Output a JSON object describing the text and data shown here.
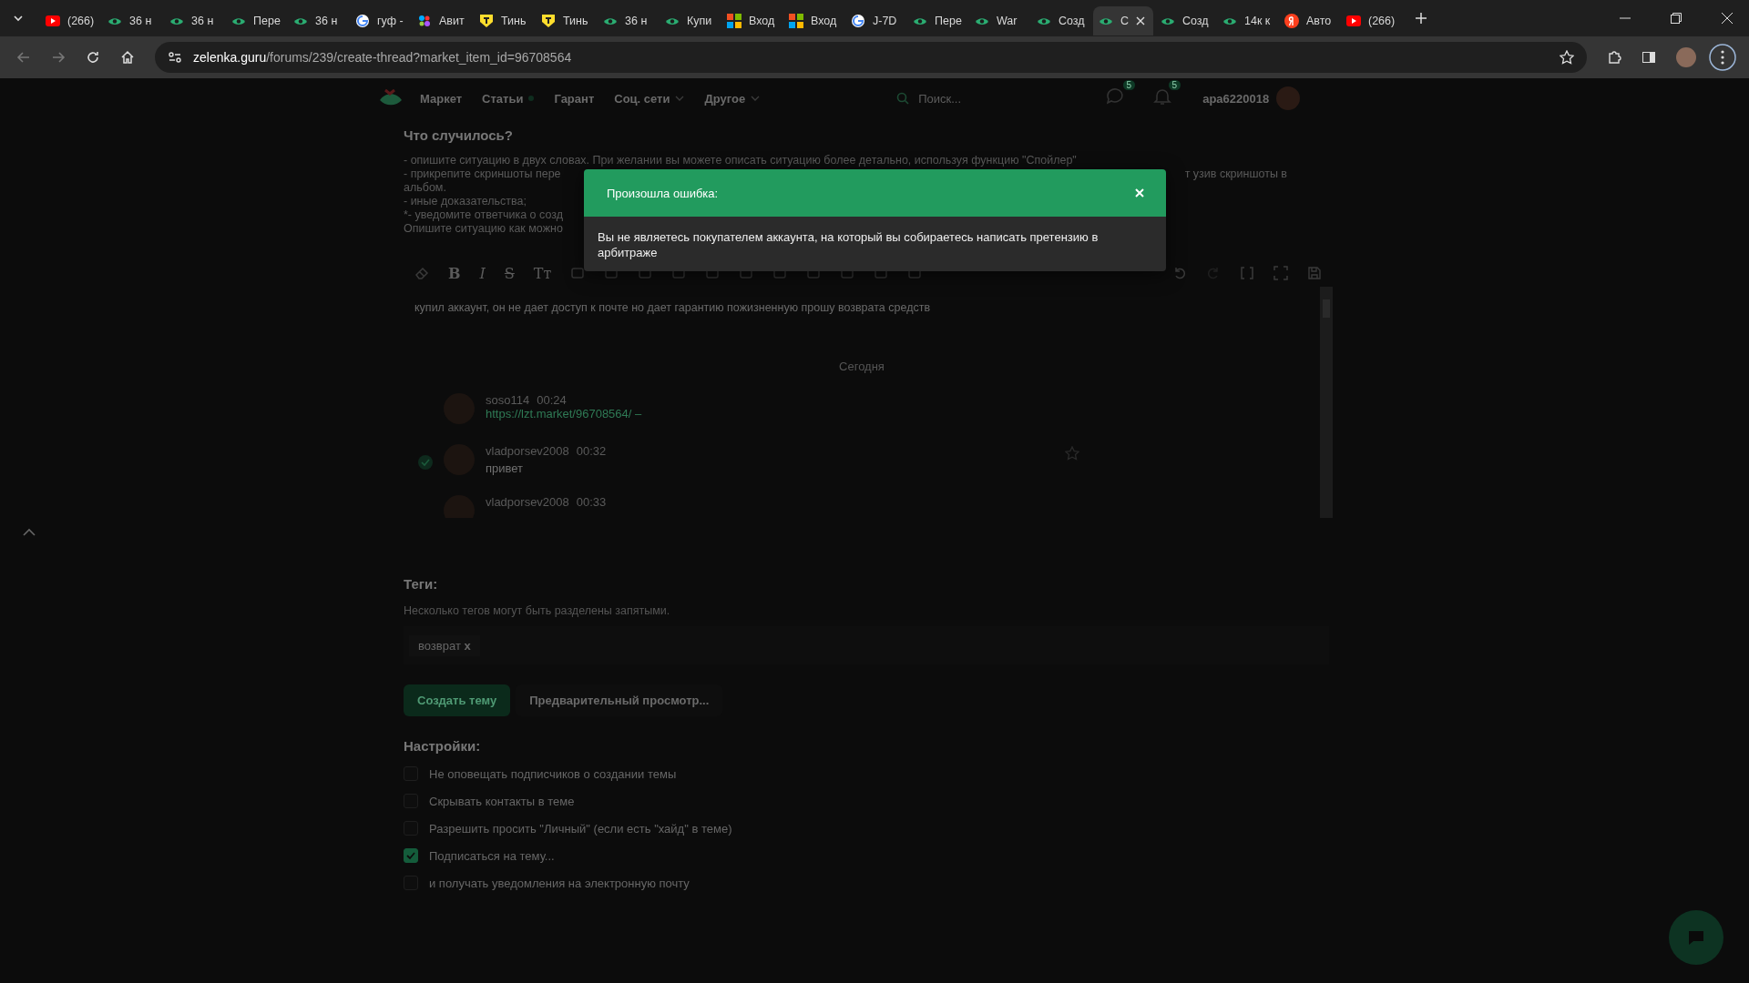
{
  "browser": {
    "tabs": [
      {
        "label": "(266)",
        "kind": "youtube",
        "selected": false
      },
      {
        "label": "36 н",
        "kind": "lolz",
        "selected": false
      },
      {
        "label": "36 н",
        "kind": "lolz",
        "selected": false
      },
      {
        "label": "Пере",
        "kind": "lolz",
        "selected": false
      },
      {
        "label": "36 н",
        "kind": "lolz",
        "selected": false
      },
      {
        "label": "гуф -",
        "kind": "google",
        "selected": false
      },
      {
        "label": "Авит",
        "kind": "avito",
        "selected": false
      },
      {
        "label": "Тинь",
        "kind": "tinkoff",
        "selected": false
      },
      {
        "label": "Тинь",
        "kind": "tinkoff",
        "selected": false
      },
      {
        "label": "36 н",
        "kind": "lolz",
        "selected": false
      },
      {
        "label": "Купи",
        "kind": "lolz",
        "selected": false
      },
      {
        "label": "Вход",
        "kind": "microsoft",
        "selected": false
      },
      {
        "label": "Вход",
        "kind": "microsoft",
        "selected": false
      },
      {
        "label": "J-7D",
        "kind": "google",
        "selected": false
      },
      {
        "label": "Пере",
        "kind": "lolz",
        "selected": false
      },
      {
        "label": "War",
        "kind": "lolz",
        "selected": false
      },
      {
        "label": "Созд",
        "kind": "lolz",
        "selected": false
      },
      {
        "label": "С",
        "kind": "lolz",
        "selected": true
      },
      {
        "label": "Созд",
        "kind": "lolz",
        "selected": false
      },
      {
        "label": "14к к",
        "kind": "lolz",
        "selected": false
      },
      {
        "label": "Авто",
        "kind": "yandex",
        "selected": false
      },
      {
        "label": "(266)",
        "kind": "youtube",
        "selected": false
      }
    ],
    "address": {
      "domain": "zelenka.guru",
      "path": "/forums/239/create-thread?market_item_id=96708564"
    }
  },
  "nav": {
    "items": [
      {
        "label": "Маркет",
        "dropdown": false,
        "dot": false
      },
      {
        "label": "Статьи",
        "dropdown": false,
        "dot": true
      },
      {
        "label": "Гарант",
        "dropdown": false,
        "dot": false
      },
      {
        "label": "Соц. сети",
        "dropdown": true,
        "dot": false
      },
      {
        "label": "Другое",
        "dropdown": true,
        "dot": false
      }
    ],
    "search_placeholder": "Поиск...",
    "badges": [
      "5",
      "5"
    ],
    "username": "apa6220018"
  },
  "form": {
    "title": "Что случилось?",
    "description": [
      {
        "left": "- опишите ситуацию в двух словах. При желании вы можете описать ситуацию более детально, используя функцию \"Спойлер\""
      },
      {
        "left": "- прикрепите скриншоты пере",
        "right": "т узив скриншоты в"
      },
      {
        "left": "альбом."
      },
      {
        "left": "- иные доказательства;"
      },
      {
        "left": "*- уведомите ответчика о созд"
      },
      {
        "left": "Опишите ситуацию как можно"
      }
    ],
    "toolbar_glyphs": [
      "B",
      "I",
      "S",
      "Tт"
    ],
    "editor_text": "купил аккаунт, он не дает доступ к почте но дает  гарантию пожизненную прошу возврата средств",
    "chat": {
      "day": "Сегодня",
      "messages": [
        {
          "author": "soso114",
          "time": "00:24",
          "text": "https://lzt.market/96708564/ –",
          "kind": "link",
          "verified": false
        },
        {
          "author": "vladporsev2008",
          "time": "00:32",
          "text": "привет",
          "kind": "text",
          "verified": true
        },
        {
          "author": "vladporsev2008",
          "time": "00:33",
          "verified": false
        }
      ]
    },
    "tags": {
      "label": "Теги:",
      "hint": "Несколько тегов могут быть разделены запятыми.",
      "chips": [
        {
          "label": "возврат",
          "remove": "x"
        }
      ]
    },
    "buttons": [
      {
        "label": "Создать тему",
        "kind": "primary"
      },
      {
        "label": "Предварительный просмотр...",
        "kind": "secondary"
      }
    ],
    "settings": {
      "title": "Настройки:",
      "options": [
        {
          "label": "Не оповещать подписчиков о создании темы",
          "checked": false
        },
        {
          "label": "Скрывать контакты в теме",
          "checked": false
        },
        {
          "label": "Разрешить просить \"Личный\" (если есть \"хайд\" в теме)",
          "checked": false
        },
        {
          "label": "Подписаться на тему...",
          "checked": true
        },
        {
          "label": "и получать уведомления на электронную почту",
          "checked": false
        }
      ]
    }
  },
  "modal": {
    "title": "Произошла ошибка:",
    "message": "Вы не являетесь покупателем аккаунта, на который вы собираетесь написать претензию в арбитраже"
  }
}
